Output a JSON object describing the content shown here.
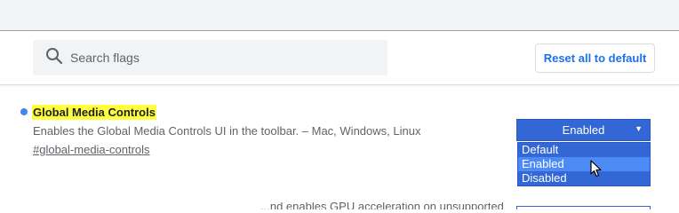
{
  "header": {
    "search": {
      "placeholder": "Search flags",
      "value": ""
    },
    "reset_label": "Reset all to default"
  },
  "experiment": {
    "title": "Global Media Controls",
    "description": "Enables the Global Media Controls UI in the toolbar. – Mac, Windows, Linux",
    "link": "#global-media-controls",
    "select": {
      "value": "Enabled",
      "options": [
        {
          "label": "Default",
          "selected": false
        },
        {
          "label": "Enabled",
          "selected": true
        },
        {
          "label": "Disabled",
          "selected": false
        }
      ]
    }
  },
  "next_experiment": {
    "description_partial": "...nd enables GPU acceleration on unsupported"
  },
  "colors": {
    "accent": "#1a73e8",
    "highlight": "#ffff40",
    "select_bg": "#3367d6",
    "option_hover": "#4c8bf5",
    "status_dot": "#4285f4"
  },
  "icons": {
    "search": "search-icon",
    "caret": "caret-down-icon",
    "cursor": "mouse-pointer-icon"
  }
}
